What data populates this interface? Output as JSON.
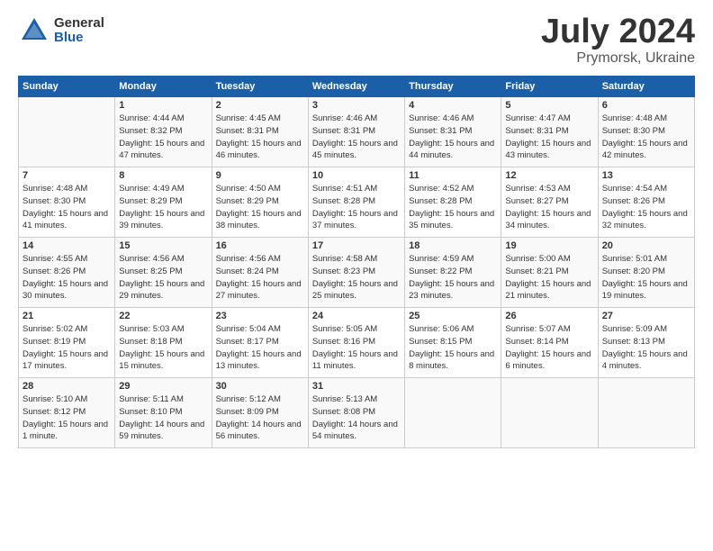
{
  "header": {
    "logo_general": "General",
    "logo_blue": "Blue",
    "title": "July 2024",
    "location": "Prymorsk, Ukraine"
  },
  "columns": [
    "Sunday",
    "Monday",
    "Tuesday",
    "Wednesday",
    "Thursday",
    "Friday",
    "Saturday"
  ],
  "weeks": [
    [
      {
        "day": "",
        "sunrise": "",
        "sunset": "",
        "daylight": ""
      },
      {
        "day": "1",
        "sunrise": "Sunrise: 4:44 AM",
        "sunset": "Sunset: 8:32 PM",
        "daylight": "Daylight: 15 hours and 47 minutes."
      },
      {
        "day": "2",
        "sunrise": "Sunrise: 4:45 AM",
        "sunset": "Sunset: 8:31 PM",
        "daylight": "Daylight: 15 hours and 46 minutes."
      },
      {
        "day": "3",
        "sunrise": "Sunrise: 4:46 AM",
        "sunset": "Sunset: 8:31 PM",
        "daylight": "Daylight: 15 hours and 45 minutes."
      },
      {
        "day": "4",
        "sunrise": "Sunrise: 4:46 AM",
        "sunset": "Sunset: 8:31 PM",
        "daylight": "Daylight: 15 hours and 44 minutes."
      },
      {
        "day": "5",
        "sunrise": "Sunrise: 4:47 AM",
        "sunset": "Sunset: 8:31 PM",
        "daylight": "Daylight: 15 hours and 43 minutes."
      },
      {
        "day": "6",
        "sunrise": "Sunrise: 4:48 AM",
        "sunset": "Sunset: 8:30 PM",
        "daylight": "Daylight: 15 hours and 42 minutes."
      }
    ],
    [
      {
        "day": "7",
        "sunrise": "Sunrise: 4:48 AM",
        "sunset": "Sunset: 8:30 PM",
        "daylight": "Daylight: 15 hours and 41 minutes."
      },
      {
        "day": "8",
        "sunrise": "Sunrise: 4:49 AM",
        "sunset": "Sunset: 8:29 PM",
        "daylight": "Daylight: 15 hours and 39 minutes."
      },
      {
        "day": "9",
        "sunrise": "Sunrise: 4:50 AM",
        "sunset": "Sunset: 8:29 PM",
        "daylight": "Daylight: 15 hours and 38 minutes."
      },
      {
        "day": "10",
        "sunrise": "Sunrise: 4:51 AM",
        "sunset": "Sunset: 8:28 PM",
        "daylight": "Daylight: 15 hours and 37 minutes."
      },
      {
        "day": "11",
        "sunrise": "Sunrise: 4:52 AM",
        "sunset": "Sunset: 8:28 PM",
        "daylight": "Daylight: 15 hours and 35 minutes."
      },
      {
        "day": "12",
        "sunrise": "Sunrise: 4:53 AM",
        "sunset": "Sunset: 8:27 PM",
        "daylight": "Daylight: 15 hours and 34 minutes."
      },
      {
        "day": "13",
        "sunrise": "Sunrise: 4:54 AM",
        "sunset": "Sunset: 8:26 PM",
        "daylight": "Daylight: 15 hours and 32 minutes."
      }
    ],
    [
      {
        "day": "14",
        "sunrise": "Sunrise: 4:55 AM",
        "sunset": "Sunset: 8:26 PM",
        "daylight": "Daylight: 15 hours and 30 minutes."
      },
      {
        "day": "15",
        "sunrise": "Sunrise: 4:56 AM",
        "sunset": "Sunset: 8:25 PM",
        "daylight": "Daylight: 15 hours and 29 minutes."
      },
      {
        "day": "16",
        "sunrise": "Sunrise: 4:56 AM",
        "sunset": "Sunset: 8:24 PM",
        "daylight": "Daylight: 15 hours and 27 minutes."
      },
      {
        "day": "17",
        "sunrise": "Sunrise: 4:58 AM",
        "sunset": "Sunset: 8:23 PM",
        "daylight": "Daylight: 15 hours and 25 minutes."
      },
      {
        "day": "18",
        "sunrise": "Sunrise: 4:59 AM",
        "sunset": "Sunset: 8:22 PM",
        "daylight": "Daylight: 15 hours and 23 minutes."
      },
      {
        "day": "19",
        "sunrise": "Sunrise: 5:00 AM",
        "sunset": "Sunset: 8:21 PM",
        "daylight": "Daylight: 15 hours and 21 minutes."
      },
      {
        "day": "20",
        "sunrise": "Sunrise: 5:01 AM",
        "sunset": "Sunset: 8:20 PM",
        "daylight": "Daylight: 15 hours and 19 minutes."
      }
    ],
    [
      {
        "day": "21",
        "sunrise": "Sunrise: 5:02 AM",
        "sunset": "Sunset: 8:19 PM",
        "daylight": "Daylight: 15 hours and 17 minutes."
      },
      {
        "day": "22",
        "sunrise": "Sunrise: 5:03 AM",
        "sunset": "Sunset: 8:18 PM",
        "daylight": "Daylight: 15 hours and 15 minutes."
      },
      {
        "day": "23",
        "sunrise": "Sunrise: 5:04 AM",
        "sunset": "Sunset: 8:17 PM",
        "daylight": "Daylight: 15 hours and 13 minutes."
      },
      {
        "day": "24",
        "sunrise": "Sunrise: 5:05 AM",
        "sunset": "Sunset: 8:16 PM",
        "daylight": "Daylight: 15 hours and 11 minutes."
      },
      {
        "day": "25",
        "sunrise": "Sunrise: 5:06 AM",
        "sunset": "Sunset: 8:15 PM",
        "daylight": "Daylight: 15 hours and 8 minutes."
      },
      {
        "day": "26",
        "sunrise": "Sunrise: 5:07 AM",
        "sunset": "Sunset: 8:14 PM",
        "daylight": "Daylight: 15 hours and 6 minutes."
      },
      {
        "day": "27",
        "sunrise": "Sunrise: 5:09 AM",
        "sunset": "Sunset: 8:13 PM",
        "daylight": "Daylight: 15 hours and 4 minutes."
      }
    ],
    [
      {
        "day": "28",
        "sunrise": "Sunrise: 5:10 AM",
        "sunset": "Sunset: 8:12 PM",
        "daylight": "Daylight: 15 hours and 1 minute."
      },
      {
        "day": "29",
        "sunrise": "Sunrise: 5:11 AM",
        "sunset": "Sunset: 8:10 PM",
        "daylight": "Daylight: 14 hours and 59 minutes."
      },
      {
        "day": "30",
        "sunrise": "Sunrise: 5:12 AM",
        "sunset": "Sunset: 8:09 PM",
        "daylight": "Daylight: 14 hours and 56 minutes."
      },
      {
        "day": "31",
        "sunrise": "Sunrise: 5:13 AM",
        "sunset": "Sunset: 8:08 PM",
        "daylight": "Daylight: 14 hours and 54 minutes."
      },
      {
        "day": "",
        "sunrise": "",
        "sunset": "",
        "daylight": ""
      },
      {
        "day": "",
        "sunrise": "",
        "sunset": "",
        "daylight": ""
      },
      {
        "day": "",
        "sunrise": "",
        "sunset": "",
        "daylight": ""
      }
    ]
  ]
}
